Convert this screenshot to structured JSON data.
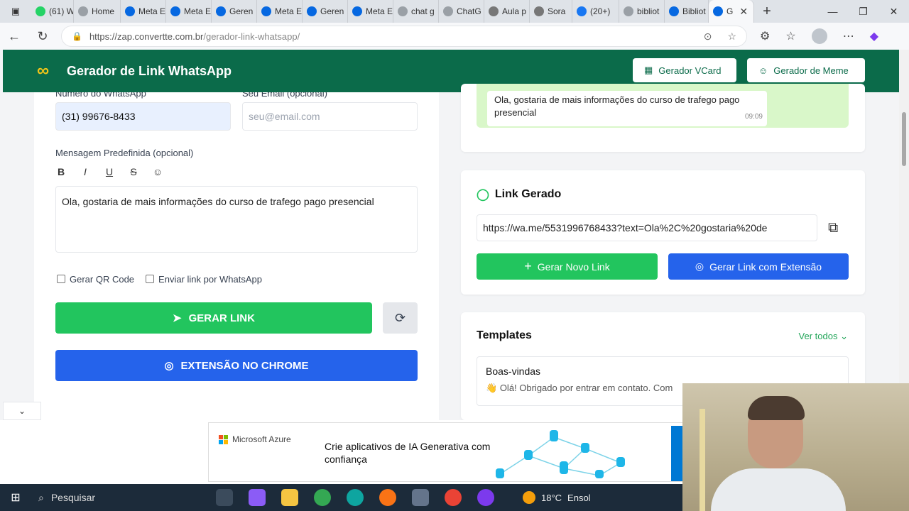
{
  "browser": {
    "tabs": [
      {
        "label": "(61) W",
        "color": "#25d366"
      },
      {
        "label": "Home",
        "color": "#9aa0a6"
      },
      {
        "label": "Meta E",
        "color": "#0668e1"
      },
      {
        "label": "Meta E",
        "color": "#0668e1"
      },
      {
        "label": "Geren",
        "color": "#0668e1"
      },
      {
        "label": "Meta E",
        "color": "#0668e1"
      },
      {
        "label": "Geren",
        "color": "#0668e1"
      },
      {
        "label": "Meta E",
        "color": "#0668e1"
      },
      {
        "label": "chat g",
        "color": "#9aa0a6"
      },
      {
        "label": "ChatG",
        "color": "#9aa0a6"
      },
      {
        "label": "Aula p",
        "color": "#777777"
      },
      {
        "label": "Sora",
        "color": "#777777"
      },
      {
        "label": "(20+)",
        "color": "#1877f2"
      },
      {
        "label": "bibliot",
        "color": "#9aa0a6"
      },
      {
        "label": "Bibliot",
        "color": "#0668e1"
      },
      {
        "label": "G",
        "color": "#0668e1"
      }
    ],
    "url_base": "https://zap.convertte.com.br",
    "url_path": "/gerador-link-whatsapp/"
  },
  "app": {
    "title": "Gerador de Link WhatsApp",
    "vcard_button": "Gerador VCard",
    "meme_button": "Gerador de Meme"
  },
  "form": {
    "phone_label": "Número do WhatsApp",
    "phone_value": "(31) 99676-8433",
    "email_label": "Seu Email (opcional)",
    "email_placeholder": "seu@email.com",
    "message_label": "Mensagem Predefinida (opcional)",
    "message_value": "Ola, gostaria de mais informações do curso de trafego pago presencial",
    "qr_label": "Gerar QR Code",
    "send_label": "Enviar link por WhatsApp",
    "generate_button": "GERAR LINK",
    "extension_button": "EXTENSÃO NO CHROME"
  },
  "preview": {
    "message": "Ola, gostaria de mais informações do curso de trafego pago presencial",
    "time": "09:09"
  },
  "link": {
    "title": "Link Gerado",
    "value": "https://wa.me/5531996768433?text=Ola%2C%20gostaria%20de",
    "new_button": "Gerar Novo Link",
    "ext_button": "Gerar Link com Extensão"
  },
  "templates": {
    "title": "Templates",
    "see_all": "Ver todos",
    "items": [
      {
        "title": "Boas-vindas",
        "emoji": "👋",
        "text": "Olá! Obrigado por entrar em contato. Com"
      }
    ]
  },
  "ad": {
    "brand": "Microsoft Azure",
    "text": "Crie aplicativos de IA Generativa com confiança"
  },
  "taskbar": {
    "search": "Pesquisar",
    "temperature": "18°C",
    "weather": "Ensol"
  },
  "colors": {
    "header_green": "#0b6b4a",
    "button_green": "#22c55e",
    "button_blue": "#2563eb",
    "preview_bg": "#d9f7c9"
  }
}
